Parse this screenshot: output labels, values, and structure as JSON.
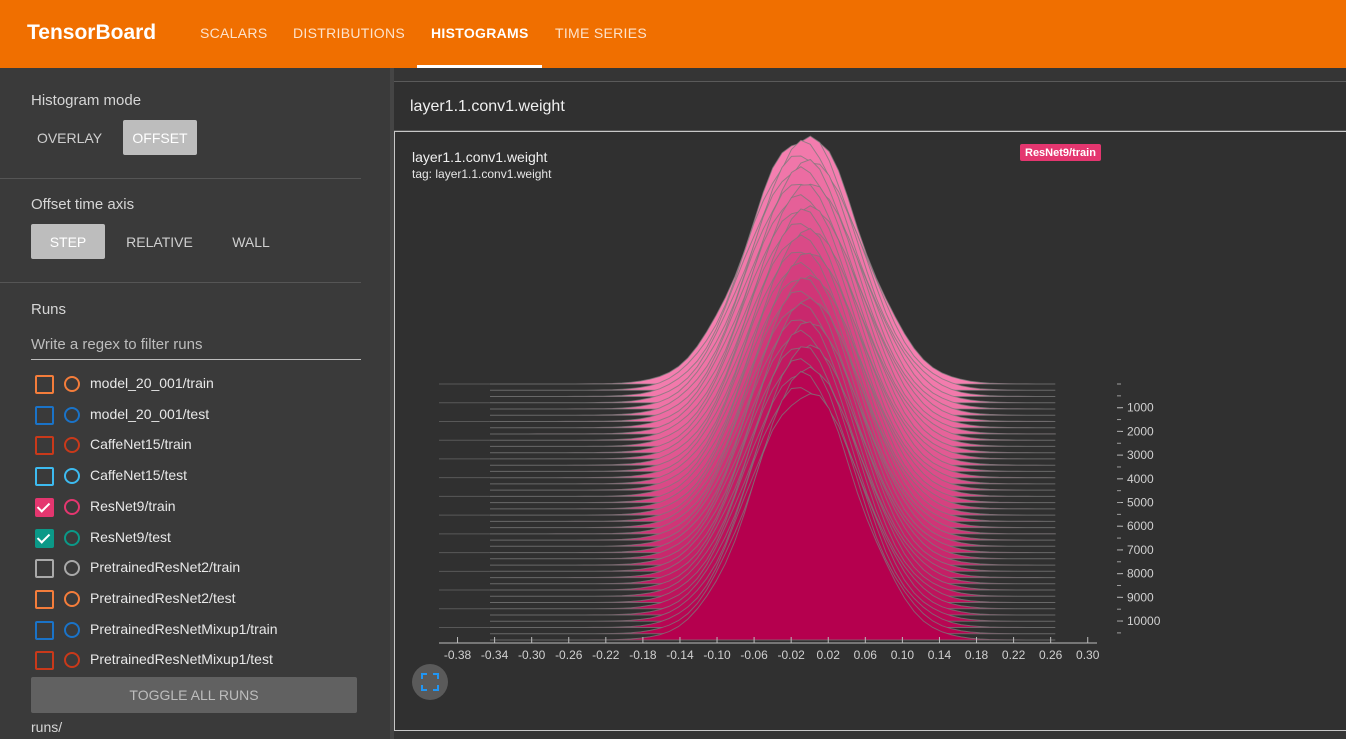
{
  "app": {
    "title": "TensorBoard"
  },
  "nav": {
    "tabs": [
      {
        "label": "SCALARS"
      },
      {
        "label": "DISTRIBUTIONS"
      },
      {
        "label": "HISTOGRAMS"
      },
      {
        "label": "TIME SERIES"
      }
    ],
    "active": "HISTOGRAMS"
  },
  "sidebar": {
    "histogram_mode": {
      "title": "Histogram mode",
      "options": [
        "OVERLAY",
        "OFFSET"
      ],
      "selected": "OFFSET"
    },
    "offset_axis": {
      "title": "Offset time axis",
      "options": [
        "STEP",
        "RELATIVE",
        "WALL"
      ],
      "selected": "STEP"
    },
    "runs": {
      "title": "Runs",
      "filter_placeholder": "Write a regex to filter runs",
      "items": [
        {
          "label": "model_20_001/train",
          "color": "#f47d3b",
          "checked": false
        },
        {
          "label": "model_20_001/test",
          "color": "#1a73c8",
          "checked": false
        },
        {
          "label": "CaffeNet15/train",
          "color": "#c9391a",
          "checked": false
        },
        {
          "label": "CaffeNet15/test",
          "color": "#3dbbf0",
          "checked": false
        },
        {
          "label": "ResNet9/train",
          "color": "#e4366f",
          "checked": true
        },
        {
          "label": "ResNet9/test",
          "color": "#0b9988",
          "checked": true
        },
        {
          "label": "PretrainedResNet2/train",
          "color": "#a9a9a9",
          "checked": false
        },
        {
          "label": "PretrainedResNet2/test",
          "color": "#f47d3b",
          "checked": false
        },
        {
          "label": "PretrainedResNetMixup1/train",
          "color": "#1a73c8",
          "checked": false
        },
        {
          "label": "PretrainedResNetMixup1/test",
          "color": "#c9391a",
          "checked": false
        }
      ],
      "toggle_label": "TOGGLE ALL RUNS",
      "log_dir": "runs/"
    }
  },
  "main": {
    "group_title": "layer1.1.conv1.weight",
    "card": {
      "title": "layer1.1.conv1.weight",
      "tag": "tag: layer1.1.conv1.weight",
      "run_chip": "ResNet9/train",
      "run_chip_color": "#e4366f",
      "expand_icon": "fullscreen-icon"
    }
  },
  "chart_data": {
    "type": "area",
    "mode": "offset",
    "run": "ResNet9/train",
    "x_ticks": [
      "-0.38",
      "-0.34",
      "-0.30",
      "-0.26",
      "-0.22",
      "-0.18",
      "-0.14",
      "-0.10",
      "-0.06",
      "-0.02",
      "0.02",
      "0.06",
      "0.10",
      "0.14",
      "0.18",
      "0.22",
      "0.26",
      "0.30"
    ],
    "y_ticks": [
      "1000",
      "2000",
      "3000",
      "4000",
      "5000",
      "6000",
      "7000",
      "8000",
      "9000",
      "10000"
    ],
    "xlim": [
      -0.4,
      0.31
    ],
    "step_range": [
      0,
      10800
    ],
    "center": -0.005,
    "spread_start": 0.082,
    "spread_end": 0.078,
    "color_top": "#f57fb0",
    "color_bottom": "#b5004e"
  }
}
